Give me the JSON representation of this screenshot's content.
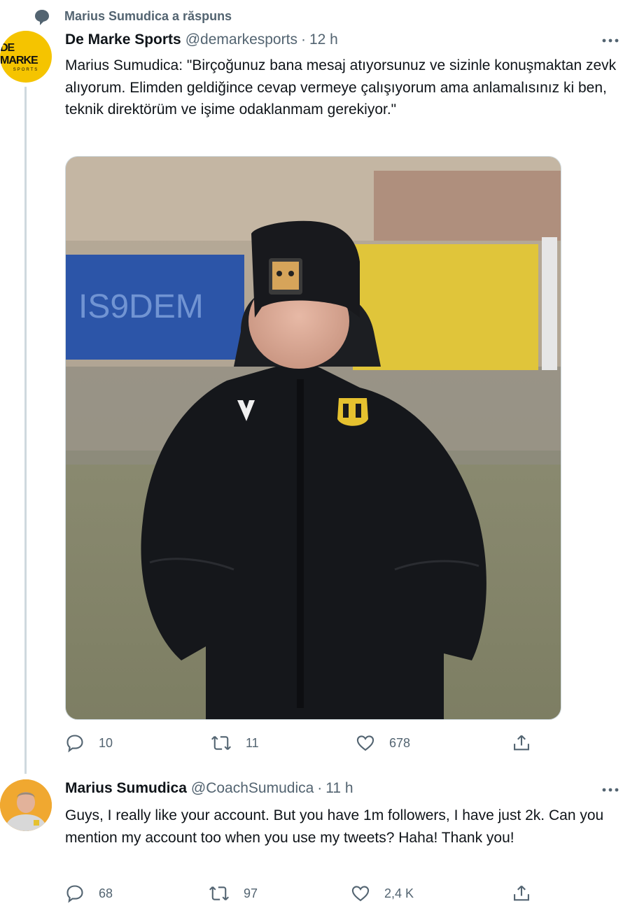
{
  "social_context": {
    "text": "Marius Sumudica a răspuns",
    "icon": "speech-bubble-icon"
  },
  "tweet1": {
    "avatar": {
      "logo_main": "DE MARKE",
      "logo_sub": "SPORTS",
      "bg": "#f5c400"
    },
    "name": "De Marke Sports",
    "handle": "@demarkesports",
    "separator": "·",
    "time": "12 h",
    "more_icon": "more-icon",
    "text": "Marius Sumudica: \"Birçoğunuz bana mesaj atıyorsunuz ve sizinle konuşmaktan zevk alıyorum. Elimden geldiğince cevap vermeye çalışıyorum ama anlamalısınız ki ben, teknik direktörüm ve işime odaklanmam gerekiyor.\"",
    "actions": {
      "replies": "10",
      "retweets": "11",
      "likes": "678"
    }
  },
  "tweet2": {
    "name": "Marius Sumudica",
    "handle": "@CoachSumudica",
    "separator": "·",
    "time": "11 h",
    "more_icon": "more-icon",
    "text": "Guys, I really like your account. But you have 1m followers, I have just 2k. Can you mention my account too when you use my tweets? Haha! Thank you!",
    "actions": {
      "replies": "68",
      "retweets": "97",
      "likes": "2,4 K"
    }
  },
  "colors": {
    "text": "#0f1419",
    "secondary": "#536471",
    "thread_line": "#cfd9de"
  }
}
